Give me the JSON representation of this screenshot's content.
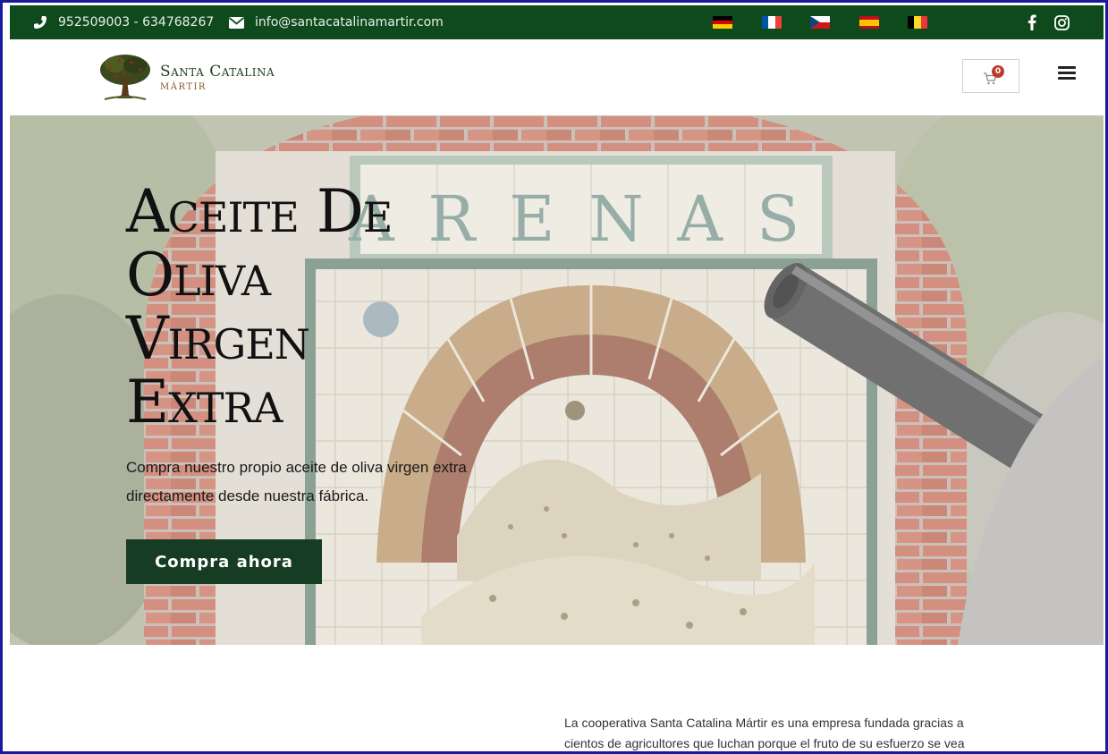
{
  "topbar": {
    "phone": "952509003 - 634768267",
    "email": "info@santacatalinamartir.com",
    "languages": [
      {
        "name": "German",
        "colors": [
          "#000000",
          "#dd0000",
          "#ffce00"
        ],
        "orientation": "horizontal"
      },
      {
        "name": "French",
        "colors": [
          "#0055a4",
          "#ffffff",
          "#ef4135"
        ],
        "orientation": "vertical"
      },
      {
        "name": "Czech",
        "colors": [
          "#ffffff",
          "#d7141a",
          "#11457e"
        ],
        "orientation": "czech"
      },
      {
        "name": "Spanish",
        "colors": [
          "#c60b1e",
          "#ffc400",
          "#c60b1e"
        ],
        "orientation": "horizontal"
      },
      {
        "name": "Belgian",
        "colors": [
          "#000000",
          "#fdda24",
          "#ef3340"
        ],
        "orientation": "vertical"
      }
    ],
    "social": [
      "facebook-icon",
      "instagram-icon"
    ],
    "background": "#0f4a1c"
  },
  "header": {
    "logo_title": "Santa Catalina",
    "logo_subtitle": "MÁRTIR",
    "cart_count": "0"
  },
  "hero": {
    "title": "Aceite De\nOliva\nVirgen\nExtra",
    "description": "Compra nuestro propio aceite de oliva virgen extra directamente desde nuestra fábrica.",
    "button_label": "Compra ahora",
    "sign_text": "ARENAS",
    "button_color": "#163d24"
  },
  "about": {
    "text": "La cooperativa Santa Catalina Mártir es una empresa fundada gracias a cientos de agricultores que luchan porque el fruto de su esfuerzo se vea"
  }
}
